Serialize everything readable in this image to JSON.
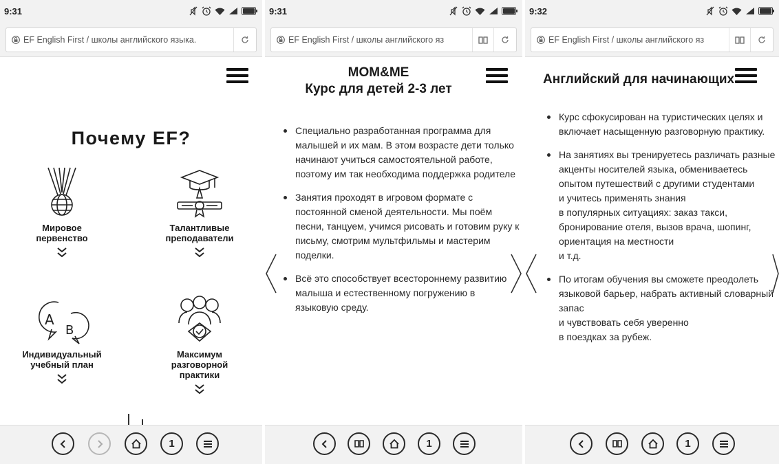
{
  "screens": [
    {
      "time": "9:31",
      "url": "EF English First / школы английского языка.",
      "heading": "Почему EF?",
      "features": [
        {
          "icon": "medal-globe-icon",
          "label": "Мировое\nпервенство"
        },
        {
          "icon": "graduation-diploma-icon",
          "label": "Талантливые\nпреподаватели"
        },
        {
          "icon": "ab-chat-icon",
          "label": "Индивидуальный\nучебный план"
        },
        {
          "icon": "group-check-icon",
          "label": "Максимум\nразговорной\nпрактики"
        }
      ],
      "bottom": {
        "tabs": "1"
      }
    },
    {
      "time": "9:31",
      "url": "EF English First / школы английского яз",
      "title": "MOM&ME\nКурс для детей 2-3 лет",
      "bullets": [
        "Специально разработанная программа для малышей и их мам. В этом возрасте дети только начинают учиться самостоятельной работе, поэтому им так необходима поддержка родителе",
        "Занятия проходят в игровом формате с постоянной сменой деятельности. Мы поём песни, танцуем, учимся рисовать и готовим руку к письму, смотрим мультфильмы и мастерим поделки.",
        "Всё это способствует всестороннему развитию малыша и естественному погружению в языковую среду."
      ],
      "bottom": {
        "tabs": "1"
      }
    },
    {
      "time": "9:32",
      "url": "EF English First / школы английского яз",
      "title": "Английский для начинающих",
      "bullets": [
        "Курс сфокусирован на туристических целях и включает насыщенную разговорную практику.",
        "На занятиях вы тренируетесь различать разные акценты носителей языка, обмениваетесь опытом путешествий с другими студентами\nи учитесь применять знания\nв популярных ситуациях: заказ такси, бронирование отеля, вызов врача, шопинг, ориентация на местности\nи т.д.",
        "По итогам обучения вы сможете преодолеть языковой барьер, набрать активный словарный запас\nи чувствовать себя уверенно\nв поездках за рубеж."
      ],
      "bottom": {
        "tabs": "1"
      }
    }
  ]
}
